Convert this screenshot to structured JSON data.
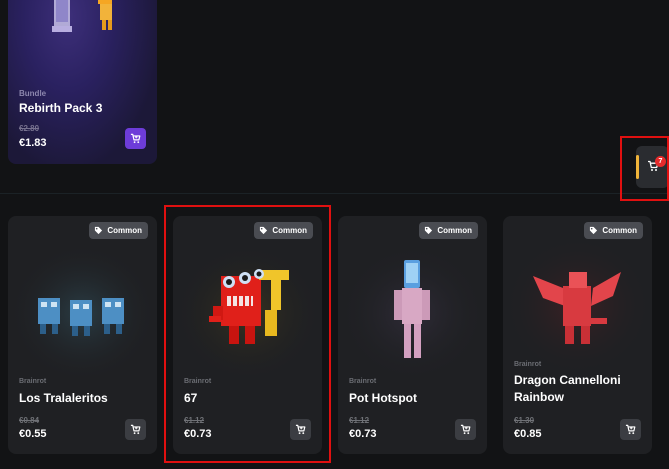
{
  "top_card": {
    "category": "Bundle",
    "title": "Rebirth Pack 3",
    "old_price": "€2.80",
    "price": "€1.83",
    "cart_icon": "cart-icon"
  },
  "side_cart": {
    "count": "7",
    "icon": "cart-icon"
  },
  "products": [
    {
      "badge": "Common",
      "category": "Brainrot",
      "title": "Los Tralaleritos",
      "old_price": "€0.84",
      "price": "€0.55"
    },
    {
      "badge": "Common",
      "category": "Brainrot",
      "title": "67",
      "old_price": "€1.12",
      "price": "€0.73"
    },
    {
      "badge": "Common",
      "category": "Brainrot",
      "title": "Pot Hotspot",
      "old_price": "€1.12",
      "price": "€0.73"
    },
    {
      "badge": "Common",
      "category": "Brainrot",
      "title": "Dragon Cannelloni Rainbow",
      "old_price": "€1.30",
      "price": "€0.85"
    }
  ],
  "colors": {
    "background": "#121315",
    "card": "#1f2023",
    "bundle_accent": "#6d3cd8",
    "badge": "#e52b2b",
    "highlight": "#e01010"
  }
}
